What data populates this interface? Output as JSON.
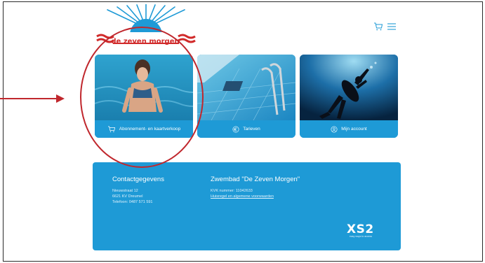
{
  "logo": {
    "text": "de zeven morgen",
    "icon": "sun-logo-icon"
  },
  "header": {
    "cart_icon": "cart-icon",
    "menu_icon": "hamburger-menu-icon"
  },
  "cards": [
    {
      "label": "Abonnement- en kaartverkoop",
      "icon": "cart-icon"
    },
    {
      "label": "Tarieven",
      "icon": "euro-icon"
    },
    {
      "label": "Mijn account",
      "icon": "user-icon"
    }
  ],
  "footer": {
    "contact_heading": "Contactgegevens",
    "address_line1": "Nieuwstraat 12",
    "address_line2": "6621 KV Dreumel",
    "phone": "Telefoon: 0487 571 591",
    "venue_heading": "Zwembad \"De Zeven Morgen\"",
    "kvk": "KVK nummer: 11042633",
    "terms_link": "Huisregel en algemene voorwaarden",
    "brand": "XS2",
    "brand_tagline": "easy ways to access"
  },
  "colors": {
    "accent": "#1e9ad6",
    "logo_red": "#d12a2a",
    "annotation_red": "#c0272d"
  }
}
